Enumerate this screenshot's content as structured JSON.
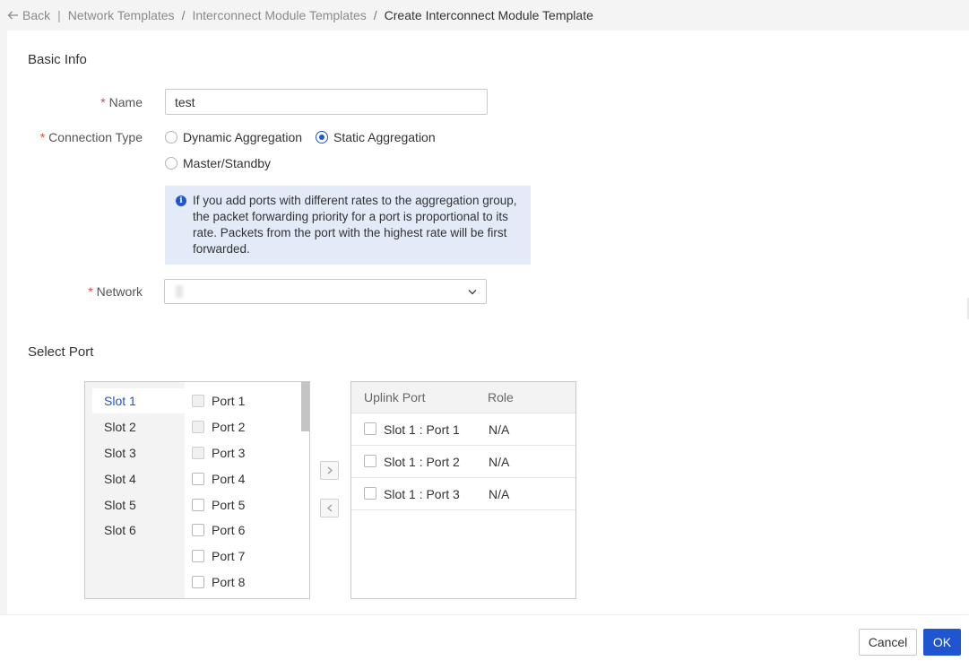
{
  "breadcrumb": {
    "back": "Back",
    "items": [
      "Network Templates",
      "Interconnect Module Templates"
    ],
    "current": "Create Interconnect Module Template"
  },
  "basic_info": {
    "title": "Basic Info",
    "name_label": "Name",
    "name_value": "test",
    "connection_type_label": "Connection Type",
    "connection_options": [
      "Dynamic Aggregation",
      "Static Aggregation",
      "Master/Standby"
    ],
    "connection_selected": "Static Aggregation",
    "info_text": "If you add ports with different rates to the aggregation group, the packet forwarding priority for a port is proportional to its rate. Packets from the port with the highest rate will be first forwarded.",
    "network_label": "Network"
  },
  "select_port": {
    "title": "Select Port",
    "slots": [
      "Slot 1",
      "Slot 2",
      "Slot 3",
      "Slot 4",
      "Slot 5",
      "Slot 6"
    ],
    "active_slot": "Slot 1",
    "ports": [
      "Port 1",
      "Port 2",
      "Port 3",
      "Port 4",
      "Port 5",
      "Port 6",
      "Port 7",
      "Port 8"
    ],
    "uplink_header": "Uplink Port",
    "role_header": "Role",
    "uplinks": [
      {
        "port": "Slot 1 : Port 1",
        "role": "N/A"
      },
      {
        "port": "Slot 1 : Port 2",
        "role": "N/A"
      },
      {
        "port": "Slot 1 : Port 3",
        "role": "N/A"
      }
    ]
  },
  "footer": {
    "cancel": "Cancel",
    "ok": "OK"
  },
  "colors": {
    "primary": "#1f55d1",
    "required": "#e54545",
    "info_bg": "#e3eaf8"
  }
}
